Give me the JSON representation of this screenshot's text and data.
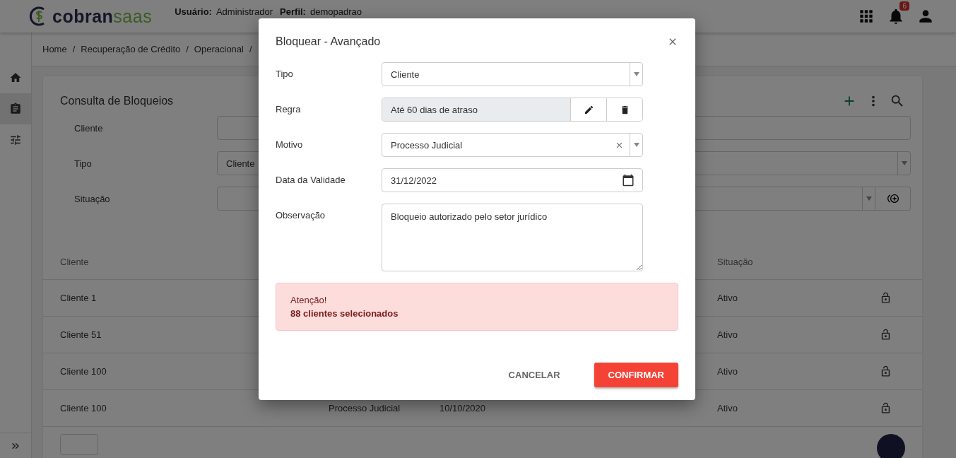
{
  "header": {
    "logo": {
      "part_1": "cobran",
      "part_2": "saas"
    },
    "user_label": "Usuário:",
    "user_value": "Administrador",
    "profile_label": "Perfil:",
    "profile_value": "demopadrao",
    "notifications_badge": "6"
  },
  "sidebar": {
    "items": [
      {
        "kind": "home",
        "selected": false
      },
      {
        "kind": "clipboard",
        "selected": true
      },
      {
        "kind": "sliders",
        "selected": false
      }
    ]
  },
  "breadcrumb": {
    "separator": "/",
    "items": [
      "Home",
      "Recuperação de Crédito",
      "Operacional"
    ]
  },
  "page": {
    "title": "Consulta de Bloqueios",
    "filters": [
      {
        "label": "Cliente",
        "kind": "input"
      },
      {
        "label": "Tipo",
        "kind": "select",
        "value": "Cliente"
      },
      {
        "label": "Situação",
        "kind": "select-button"
      }
    ]
  },
  "table": {
    "column_1": "Cliente",
    "column_4": "Situação",
    "rows": [
      {
        "column_1": "Cliente 1",
        "column_4": "Ativo",
        "locked": false
      },
      {
        "column_1": "Cliente 51",
        "column_4": "Ativo",
        "locked": false
      },
      {
        "column_1": "Cliente 100",
        "column_4": "Ativo",
        "locked": false
      },
      {
        "column_1": "Cliente 100",
        "column_2": "Processo Judicial",
        "column_3": "10/10/2020",
        "column_4": "Ativo",
        "locked": false
      }
    ]
  },
  "dialog": {
    "title": "Bloquear - Avançado",
    "fields": [
      {
        "label": "Tipo",
        "kind": "select",
        "value": "Cliente",
        "clearable": false
      },
      {
        "label": "Regra",
        "kind": "rule",
        "value": "Até 60 dias de atraso"
      },
      {
        "label": "Motivo",
        "kind": "select",
        "value": "Processo Judicial",
        "clearable": true
      },
      {
        "label": "Data da Validade",
        "kind": "date",
        "value": "31/12/2022"
      },
      {
        "label": "Observação",
        "kind": "textarea",
        "value": "Bloqueio autorizado pelo setor jurídico"
      }
    ],
    "alert": {
      "title": "Atenção!",
      "message": "88 clientes selecionados"
    },
    "buttons": [
      {
        "label": "CANCELAR",
        "kind": "text"
      },
      {
        "label": "CONFIRMAR",
        "kind": "primary"
      }
    ]
  }
}
